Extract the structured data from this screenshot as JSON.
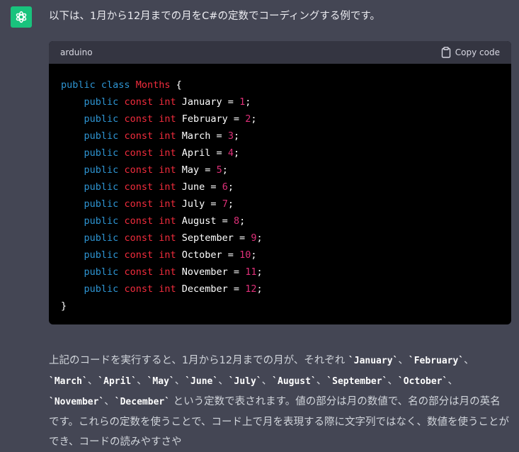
{
  "assistant": {
    "avatar_icon": "openai-logo-icon",
    "avatar_color": "#19c37d"
  },
  "intro_text": "以下は、1月から12月までの月をC#の定数でコーディングする例です。",
  "code_block": {
    "language": "arduino",
    "copy_label": "Copy code",
    "class_keyword_1": "public",
    "class_keyword_2": "class",
    "class_name": "Months",
    "open_brace": "{",
    "close_brace": "}",
    "members": [
      {
        "name": "January",
        "value": "1"
      },
      {
        "name": "February",
        "value": "2"
      },
      {
        "name": "March",
        "value": "3"
      },
      {
        "name": "April",
        "value": "4"
      },
      {
        "name": "May",
        "value": "5"
      },
      {
        "name": "June",
        "value": "6"
      },
      {
        "name": "July",
        "value": "7"
      },
      {
        "name": "August",
        "value": "8"
      },
      {
        "name": "September",
        "value": "9"
      },
      {
        "name": "October",
        "value": "10"
      },
      {
        "name": "November",
        "value": "11"
      },
      {
        "name": "December",
        "value": "12"
      }
    ],
    "member_kw_public": "public",
    "member_kw_const": "const",
    "member_kw_int": "int",
    "equals": "=",
    "semicolon": ";"
  },
  "explanation": {
    "part1": "上記のコードを実行すると、1月から12月までの月が、それぞれ",
    "month_codes": [
      "`January`",
      "`February`",
      "`March`",
      "`April`",
      "`May`",
      "`June`",
      "`July`",
      "`August`",
      "`September`",
      "`October`",
      "`November`",
      "`December`"
    ],
    "separator": "、",
    "part2": "という定数で表されます。値の部分は月の数値で、名の部分は月の英名です。これらの定数を使うことで、コード上で月を表現する際に文字列ではなく、数値を使うことができ、コードの読みやすさや"
  },
  "colors": {
    "page_bg": "#444654",
    "code_header_bg": "#343541",
    "code_bg": "#000000",
    "keyword_blue": "#2e95d3",
    "keyword_red": "#f22c3d",
    "number": "#df3079"
  }
}
